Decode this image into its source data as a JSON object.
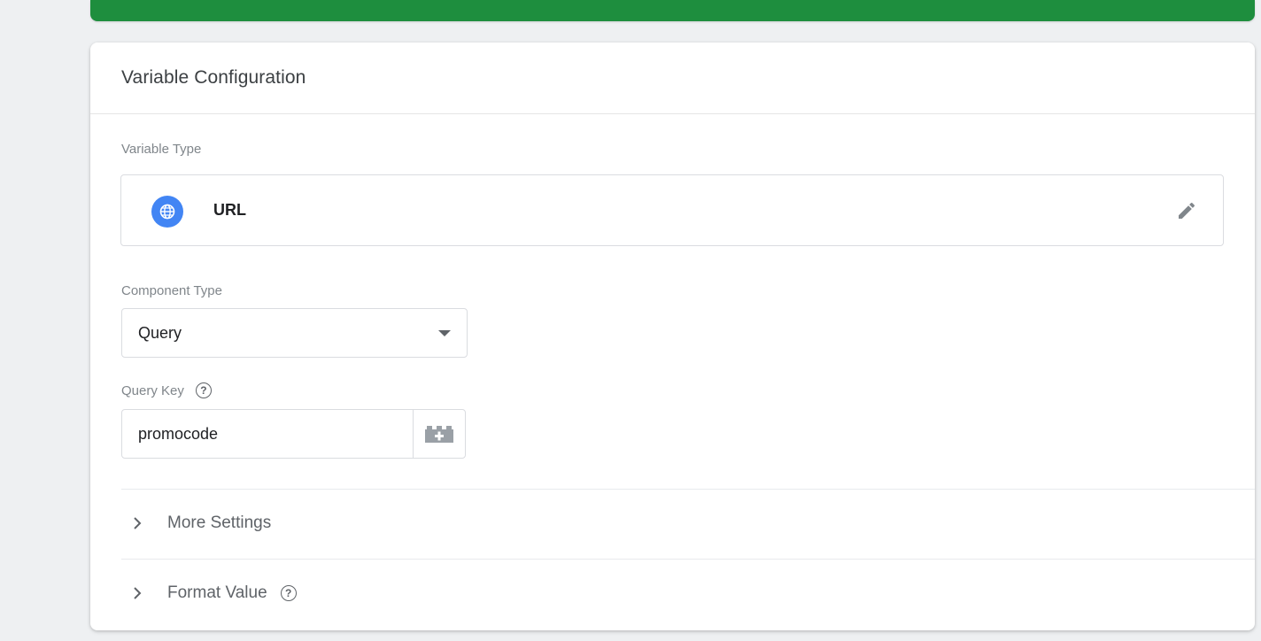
{
  "card": {
    "title": "Variable Configuration"
  },
  "variable_type": {
    "label": "Variable Type",
    "value": "URL",
    "icon": "globe-icon",
    "edit_icon": "pencil-icon"
  },
  "component_type": {
    "label": "Component Type",
    "selected": "Query"
  },
  "query_key": {
    "label": "Query Key",
    "value": "promocode",
    "help_icon": "help-icon",
    "picker_icon": "variable-picker-icon"
  },
  "sections": {
    "more_settings": "More Settings",
    "format_value": "Format Value"
  },
  "colors": {
    "accent_green": "#1e8e3e",
    "globe_blue": "#4285f4"
  }
}
